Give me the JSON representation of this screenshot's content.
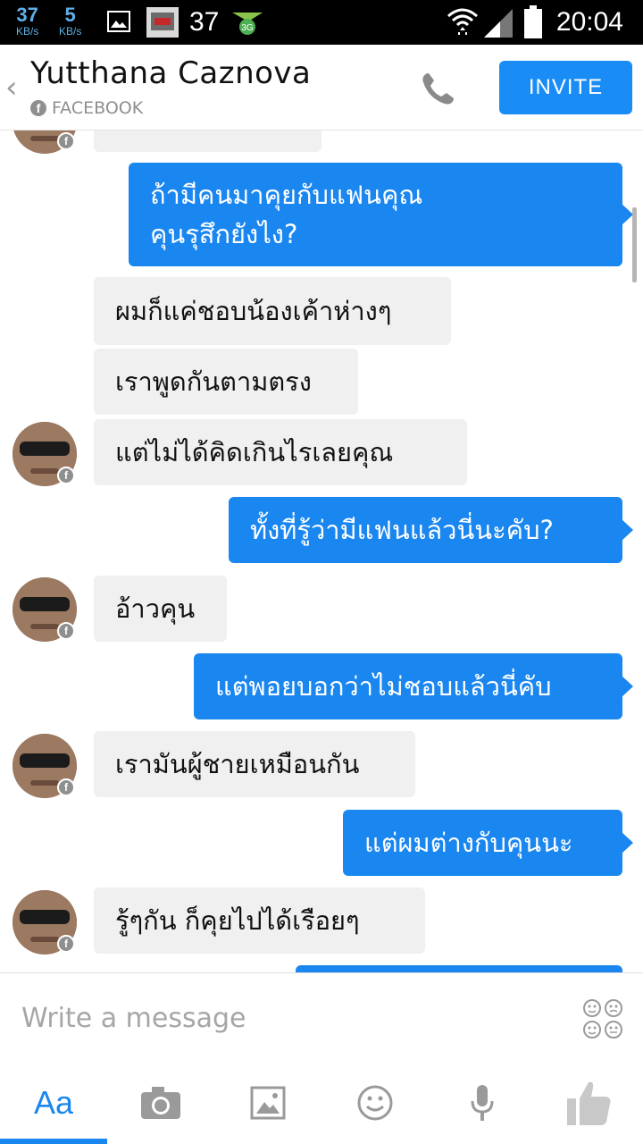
{
  "status_bar": {
    "down_speed": "37",
    "down_unit": "KB/s",
    "up_speed": "5",
    "up_unit": "KB/s",
    "notification_count": "37",
    "time": "20:04",
    "icons": [
      "image-icon",
      "app-icon",
      "3g-icon",
      "wifi-icon",
      "signal-icon",
      "battery-icon"
    ]
  },
  "header": {
    "contact_name": "Yutthana Caznova",
    "source_label": "FACEBOOK",
    "invite_label": "INVITE"
  },
  "messages": [
    {
      "direction": "in",
      "text": "",
      "avatar": true
    },
    {
      "direction": "out",
      "lines": [
        "ถ้ามีคนมาคุยกับแฟนคุณ",
        "คุนรุสึกยังไง?"
      ]
    },
    {
      "direction": "in",
      "text": "ผมก็แค่ชอบน้องเค้าห่างๆ"
    },
    {
      "direction": "in",
      "text": "เราพูดกันตามตรง"
    },
    {
      "direction": "in",
      "text": "แต่ไม่ได้คิดเกินไรเลยคุณ",
      "avatar": true
    },
    {
      "direction": "out",
      "text": "ทั้งที่รู้ว่ามีแฟนแล้วนี่นะคับ?"
    },
    {
      "direction": "in",
      "text": "อ้าวคุน",
      "avatar": true
    },
    {
      "direction": "out",
      "text": "แต่พอยบอกว่าไม่ชอบแล้วนี่คับ"
    },
    {
      "direction": "in",
      "text": "เรามันผู้ชายเหมือนกัน",
      "avatar": true
    },
    {
      "direction": "out",
      "text": "แต่ผมต่างกับคุนนะ"
    },
    {
      "direction": "in",
      "text": "รู้ๆกัน ก็คุยไปได้เรือยๆ",
      "avatar": true
    },
    {
      "direction": "out",
      "text": ""
    }
  ],
  "composer": {
    "placeholder": "Write a message"
  },
  "toolbar": {
    "text_label": "Aa",
    "items": [
      "text-tab",
      "camera-icon",
      "gallery-icon",
      "emoji-icon",
      "microphone-icon",
      "like-icon"
    ]
  },
  "colors": {
    "accent": "#1a86f0",
    "incoming_bubble": "#f0f0f0",
    "status_bar": "#000000"
  }
}
